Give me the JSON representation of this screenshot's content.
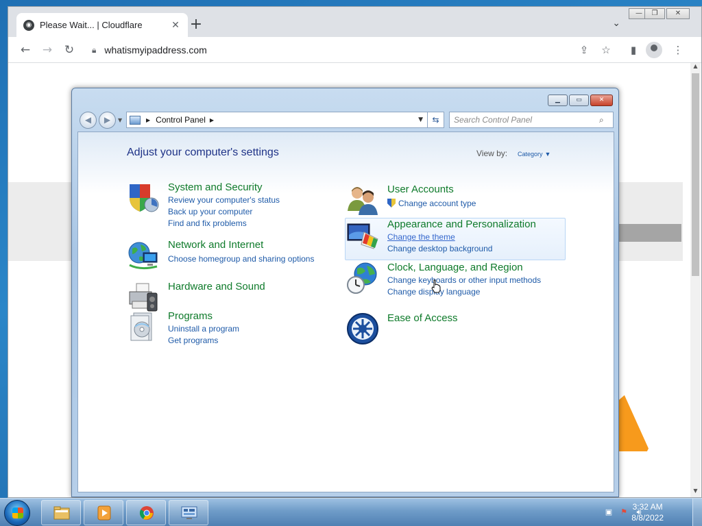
{
  "browser": {
    "tab_title": "Please Wait... | Cloudflare",
    "url": "whatismyipaddress.com",
    "icons": [
      "globe-icon",
      "close-icon",
      "plus-icon",
      "chevron-down-icon",
      "back-icon",
      "forward-icon",
      "reload-icon",
      "lock-icon",
      "share-icon",
      "star-icon",
      "side-panel-icon",
      "profile-icon",
      "kebab-menu-icon"
    ]
  },
  "control_panel": {
    "breadcrumb": "Control Panel",
    "search_placeholder": "Search Control Panel",
    "heading": "Adjust your computer's settings",
    "view_by_label": "View by:",
    "view_by_value": "Category",
    "categories_left": [
      {
        "title": "System and Security",
        "links": [
          "Review your computer's status",
          "Back up your computer",
          "Find and fix problems"
        ]
      },
      {
        "title": "Network and Internet",
        "links": [
          "Choose homegroup and sharing options"
        ]
      },
      {
        "title": "Hardware and Sound",
        "links": []
      },
      {
        "title": "Programs",
        "links": [
          "Uninstall a program",
          "Get programs"
        ]
      }
    ],
    "categories_right": [
      {
        "title": "User Accounts",
        "links": [
          "Change account type"
        ]
      },
      {
        "title": "Appearance and Personalization",
        "links": [
          "Change the theme",
          "Change desktop background"
        ]
      },
      {
        "title": "Clock, Language, and Region",
        "links": [
          "Change keyboards or other input methods",
          "Change display language"
        ]
      },
      {
        "title": "Ease of Access",
        "links": []
      }
    ]
  },
  "taskbar": {
    "time": "3:32 AM",
    "date": "8/8/2022",
    "pinned": [
      "file-explorer-icon",
      "media-player-icon",
      "chrome-icon",
      "control-panel-icon"
    ]
  },
  "colors": {
    "category_title": "#0e7a2a",
    "link": "#1e5aa8",
    "heading": "#1e3287"
  }
}
